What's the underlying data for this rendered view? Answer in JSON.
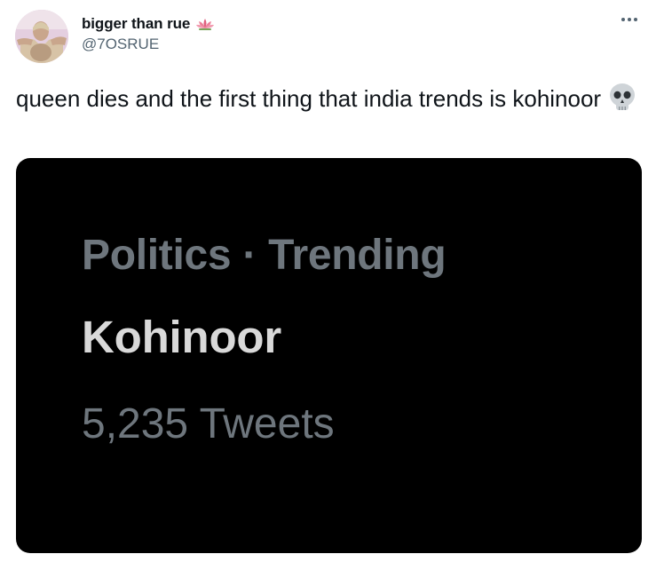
{
  "author": {
    "display_name": "bigger than rue",
    "handle": "@7OSRUE",
    "name_emoji_icon": "lotus-icon",
    "avatar_icon": "avatar-photo"
  },
  "menu": {
    "more_icon": "ellipsis-icon"
  },
  "tweet": {
    "text": "queen dies and the first thing that india trends is kohinoor",
    "trailing_emoji_icon": "skull-icon"
  },
  "media": {
    "category": "Politics · Trending",
    "topic": "Kohinoor",
    "count": "5,235 Tweets"
  },
  "colors": {
    "text_primary": "#0f1419",
    "text_secondary": "#536471",
    "media_background": "#000000",
    "media_muted_text": "#6e767d",
    "media_bright_text": "#d9d9d9",
    "lotus_color": "#e0607e"
  }
}
